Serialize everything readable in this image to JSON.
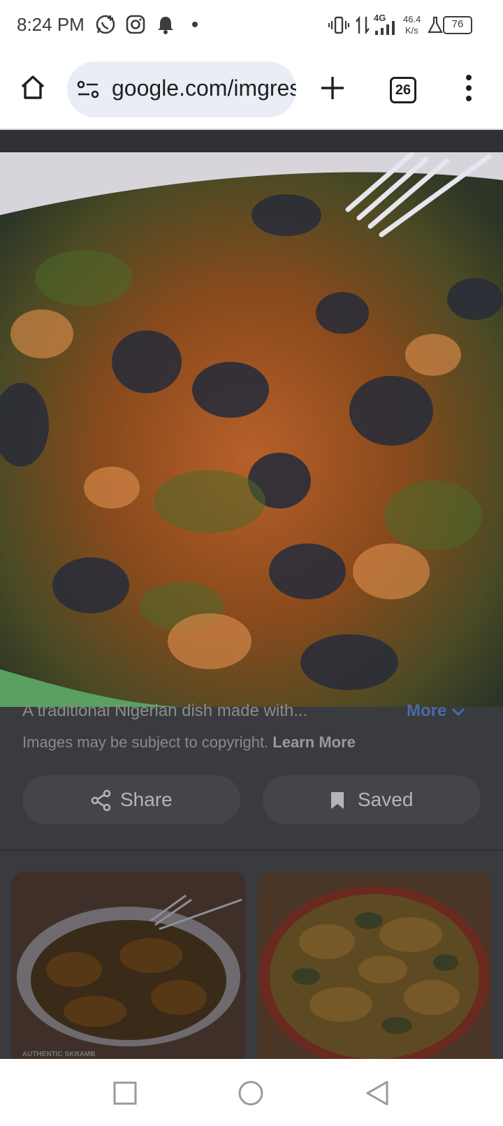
{
  "status_bar": {
    "time": "8:24 PM",
    "network": "4G",
    "speed_value": "46.4",
    "speed_unit": "K/s",
    "battery": "76"
  },
  "browser": {
    "url": "google.com/imgres",
    "tab_count": "26"
  },
  "image_panel": {
    "caption": "A traditional Nigerian dish made with...",
    "more_label": "More",
    "copyright_text": "Images may be subject to copyright.",
    "learn_more": "Learn More",
    "share_label": "Share",
    "saved_label": "Saved"
  },
  "related": {
    "watermark": "AUTHENTIC SKRAMB"
  },
  "colors": {
    "url_bar": "#e9eef6",
    "overlay": "#2a2b2e",
    "link": "#4a6aa8"
  }
}
